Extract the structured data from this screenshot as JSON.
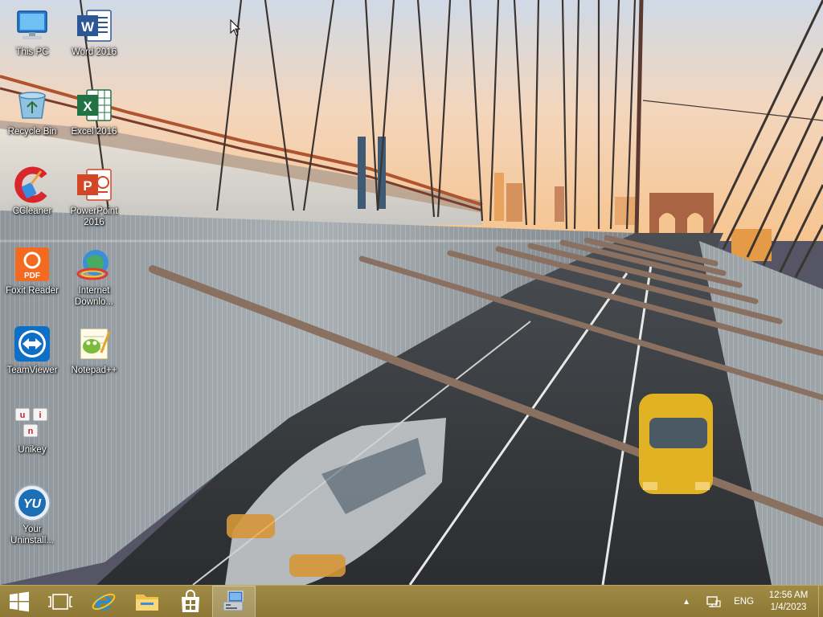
{
  "desktop": {
    "icons": [
      {
        "label": "This PC",
        "icon": "computer-icon"
      },
      {
        "label": "Word 2016",
        "icon": "word-icon"
      },
      {
        "label": "Recycle Bin",
        "icon": "recycle-bin-icon"
      },
      {
        "label": "Excel 2016",
        "icon": "excel-icon"
      },
      {
        "label": "CCleaner",
        "icon": "ccleaner-icon"
      },
      {
        "label": "PowerPoint\n2016",
        "icon": "powerpoint-icon"
      },
      {
        "label": "Foxit Reader",
        "icon": "foxit-pdf-icon"
      },
      {
        "label": "Internet\nDownlo...",
        "icon": "internet-download-manager-icon"
      },
      {
        "label": "TeamViewer",
        "icon": "teamviewer-icon"
      },
      {
        "label": "Notepad++",
        "icon": "notepad-plus-plus-icon"
      },
      {
        "label": "Unikey",
        "icon": "unikey-icon"
      },
      {
        "label": "Your\nUninstall...",
        "icon": "your-uninstaller-icon"
      }
    ]
  },
  "taskbar": {
    "color": "#98833f",
    "pinned": [
      {
        "name": "start-button",
        "icon": "windows-logo-icon"
      },
      {
        "name": "task-view-button",
        "icon": "task-view-icon"
      },
      {
        "name": "internet-explorer-button",
        "icon": "internet-explorer-icon"
      },
      {
        "name": "file-explorer-button",
        "icon": "folder-icon"
      },
      {
        "name": "store-button",
        "icon": "store-bag-icon"
      },
      {
        "name": "active-app-button",
        "icon": "network-app-icon"
      }
    ],
    "tray": {
      "chevron": "▲",
      "language": "ENG",
      "time": "12:56 AM",
      "date": "1/4/2023"
    }
  }
}
